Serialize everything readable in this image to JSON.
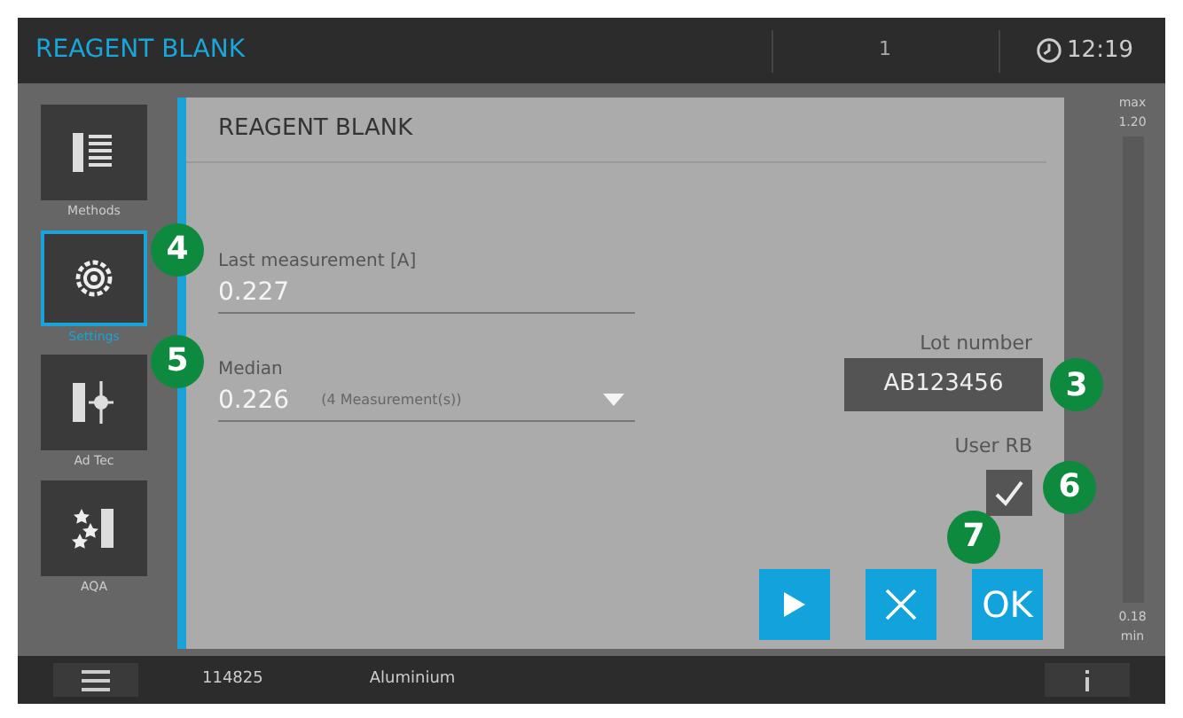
{
  "top_bar": {
    "title": "REAGENT BLANK",
    "counter": "1",
    "time": "12:19"
  },
  "sidebar": {
    "items": [
      {
        "kind": "methods",
        "label": "Methods",
        "selected": false
      },
      {
        "kind": "settings",
        "label": "Settings",
        "selected": true
      },
      {
        "kind": "adtec",
        "label": "Ad Tec",
        "selected": false
      },
      {
        "kind": "aqa",
        "label": "AQA",
        "selected": false
      }
    ]
  },
  "panel": {
    "title": "REAGENT BLANK",
    "last_measurement": {
      "label": "Last measurement [A]",
      "value": "0.227",
      "callout": "4"
    },
    "median": {
      "label": "Median",
      "value": "0.226",
      "option": "(4 Measurement(s))",
      "callout": "5"
    },
    "lot_number": {
      "label": "Lot number",
      "value": "AB123456",
      "callout": "3"
    },
    "user_rb": {
      "label": "User RB",
      "checked": true,
      "callout": "6"
    },
    "buttons": [
      {
        "kind": "play"
      },
      {
        "kind": "cancel"
      },
      {
        "kind": "ok",
        "label": "OK",
        "callout": "7"
      }
    ]
  },
  "scale": {
    "max_label": "max",
    "max_value": "1.20",
    "min_value": "0.18",
    "min_label": "min"
  },
  "bottom_bar": {
    "code": "114825",
    "name": "Aluminium"
  }
}
